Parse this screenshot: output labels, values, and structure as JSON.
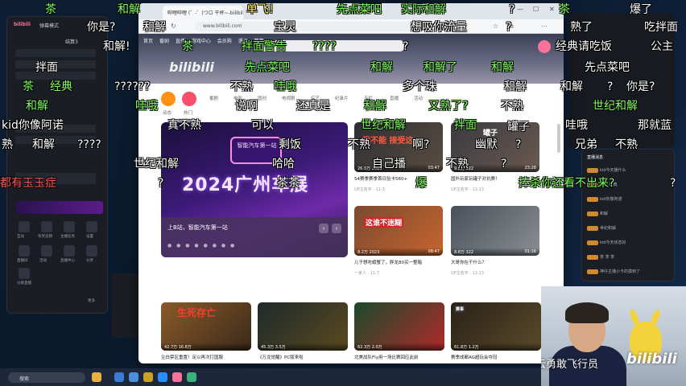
{
  "colors": {
    "accent_pink": "#fb7299",
    "danmaku_green": "#7dff5b",
    "danmaku_white": "#ffffff",
    "danmaku_yellow": "#fff36a",
    "danmaku_red": "#ff5b5b"
  },
  "left_panel": {
    "header_text": "bilibili",
    "header_tab": "弹幕模式",
    "header_right": "结算3",
    "icons": [
      {
        "label": "互动",
        "icon": "interact-icon"
      },
      {
        "label": "有奖竞猜",
        "icon": "gift-icon"
      },
      {
        "label": "主播任务",
        "icon": "task-icon"
      },
      {
        "label": "设置",
        "icon": "gear-icon"
      },
      {
        "label": "直播间",
        "icon": "room-icon"
      },
      {
        "label": "活动",
        "icon": "event-icon"
      },
      {
        "label": "直播中心",
        "icon": "center-icon"
      },
      {
        "label": "分享",
        "icon": "share-icon"
      }
    ],
    "bottom_label": "分屏直播",
    "more_label": "更多"
  },
  "browser": {
    "tab_title": "哔哩哔哩 (゜-゜)つロ 干杯~-bilibili",
    "url": "www.bilibili.com",
    "nav_items": [
      "首页",
      "番剧",
      "直播",
      "游戏中心",
      "会员购",
      "漫画",
      "赛事"
    ],
    "logo": "bilibili",
    "channels": [
      "动态",
      "热门",
      "番剧",
      "电影",
      "国创",
      "电视剧",
      "综艺",
      "纪录片",
      "专栏",
      "直播",
      "活动"
    ],
    "carousel": {
      "big_text": "2024广州车展",
      "sign_text": "智能汽车第一站",
      "caption": "上B站，智能汽车第一站",
      "prev": "‹",
      "next": "›"
    },
    "cards": [
      {
        "thumb_text": "我不能\n接受这",
        "meta": "26.5万  2083",
        "duration": "03:47",
        "title": "S4赛季赛季首日验卡560+",
        "sub": "UP主名字 · 11-3"
      },
      {
        "thumb_text": "罐子",
        "meta": "9.2万  322",
        "duration": "23:28",
        "title": "国外玩家玩罐子对抗赛！",
        "sub": "UP主名字 · 11-13"
      },
      {
        "thumb_text": "这谁不迷糊",
        "meta": "8.2万  2023",
        "duration": "08:47",
        "title": "儿子想吃螃蟹了，胖龙80买一整箱",
        "sub": "一家人 · 11-7"
      },
      {
        "thumb_text": "",
        "meta": "8.8万  322",
        "duration": "01:16",
        "title": "大哥你在干什么？",
        "sub": "UP主名字 · 11-13"
      },
      {
        "thumb_text": "生死存亡",
        "meta": "42.7万  16.8万",
        "duration": "",
        "title": "尘白禁区重置！足以再次打国服",
        "sub": "尘白禁区"
      },
      {
        "thumb_text": "",
        "meta": "45.3万  3.5万",
        "duration": "",
        "title": "《万龙觉醒》PC版来啦",
        "sub": "万龙觉醒"
      },
      {
        "thumb_text": "",
        "meta": "62.3万  2.0万",
        "duration": "",
        "title": "北美战队Fly用一场比赛回应此前",
        "sub": "英雄联盟"
      },
      {
        "thumb_text": "",
        "meta": "61.8万  1.2万",
        "duration": "",
        "title": "赛季成都AG超玩会夺冠",
        "sub": "赛事"
      }
    ],
    "card4_badge": "赛事"
  },
  "right_panel": {
    "header": "直播消息",
    "chat": [
      "kid今天播什么",
      "拌面 经典",
      "kid你像阿诺",
      "和解",
      "世纪和解",
      "kid今天状态好",
      "茶 茶 茶",
      "神仔主播小卡的摸到了"
    ]
  },
  "webcam": {
    "caption": "德云勇敢飞行员",
    "brand": "bilibili"
  },
  "taskbar": {
    "search_label": "搜索"
  },
  "danmaku": [
    {
      "text": "茶",
      "c": "g"
    },
    {
      "text": "和解",
      "c": "g"
    },
    {
      "text": "单飞!",
      "c": "y"
    },
    {
      "text": "先点菜吧",
      "c": "g"
    },
    {
      "text": "实际和解",
      "c": "g"
    },
    {
      "text": "?",
      "c": "w"
    },
    {
      "text": "茶",
      "c": "g"
    },
    {
      "text": "爆了",
      "c": "w"
    },
    {
      "text": "你是?",
      "c": "w"
    },
    {
      "text": "和解",
      "c": "w"
    },
    {
      "text": "宝灵",
      "c": "w"
    },
    {
      "text": "想吸你流量",
      "c": "w"
    },
    {
      "text": "?",
      "c": "w"
    },
    {
      "text": "熟了",
      "c": "w"
    },
    {
      "text": "吃拌面",
      "c": "w"
    },
    {
      "text": "和解!",
      "c": "w"
    },
    {
      "text": "茶",
      "c": "g"
    },
    {
      "text": "拌面警告",
      "c": "g"
    },
    {
      "text": "????",
      "c": "g"
    },
    {
      "text": "?",
      "c": "w"
    },
    {
      "text": "经典请吃饭",
      "c": "w"
    },
    {
      "text": "公主",
      "c": "w"
    },
    {
      "text": "拌面",
      "c": "w"
    },
    {
      "text": "先点菜吧",
      "c": "g"
    },
    {
      "text": "和解",
      "c": "g"
    },
    {
      "text": "和解了",
      "c": "g"
    },
    {
      "text": "和解",
      "c": "g"
    },
    {
      "text": "先点菜吧",
      "c": "w"
    },
    {
      "text": "茶",
      "c": "g"
    },
    {
      "text": "经典",
      "c": "g"
    },
    {
      "text": "??????",
      "c": "w"
    },
    {
      "text": "不熟",
      "c": "w"
    },
    {
      "text": "哇哦",
      "c": "g"
    },
    {
      "text": "多个珠",
      "c": "w"
    },
    {
      "text": "和解",
      "c": "w"
    },
    {
      "text": "和解",
      "c": "w"
    },
    {
      "text": "?",
      "c": "w"
    },
    {
      "text": "你是?",
      "c": "w"
    },
    {
      "text": "和解",
      "c": "g"
    },
    {
      "text": "哇哦",
      "c": "g"
    },
    {
      "text": "说啊",
      "c": "w"
    },
    {
      "text": "还真是",
      "c": "w"
    },
    {
      "text": "和解",
      "c": "g"
    },
    {
      "text": "又熟了?",
      "c": "g"
    },
    {
      "text": "不熟",
      "c": "w"
    },
    {
      "text": "世纪和解",
      "c": "g"
    },
    {
      "text": "kid你像阿诺",
      "c": "w"
    },
    {
      "text": "真不熟",
      "c": "w"
    },
    {
      "text": "可以",
      "c": "w"
    },
    {
      "text": "世纪和解",
      "c": "g"
    },
    {
      "text": "拌面",
      "c": "g"
    },
    {
      "text": "哇哦",
      "c": "w"
    },
    {
      "text": "那就蓝",
      "c": "w"
    },
    {
      "text": "熟",
      "c": "w"
    },
    {
      "text": "和解",
      "c": "w"
    },
    {
      "text": "????",
      "c": "w"
    },
    {
      "text": "剩饭",
      "c": "w"
    },
    {
      "text": "不熟",
      "c": "w"
    },
    {
      "text": "啊?",
      "c": "w"
    },
    {
      "text": "幽默",
      "c": "w"
    },
    {
      "text": "?",
      "c": "w"
    },
    {
      "text": "兄弟",
      "c": "w"
    },
    {
      "text": "不熟",
      "c": "w"
    },
    {
      "text": "世纪和解",
      "c": "w"
    },
    {
      "text": "哈哈",
      "c": "w"
    },
    {
      "text": "自己播",
      "c": "w"
    },
    {
      "text": "不熟",
      "c": "w"
    },
    {
      "text": "?",
      "c": "w"
    },
    {
      "text": "罐子",
      "c": "w"
    },
    {
      "text": "都有玉玉症",
      "c": "r"
    },
    {
      "text": "茶茶",
      "c": "w"
    },
    {
      "text": "爆",
      "c": "g"
    },
    {
      "text": "捧杀你还看不出来?",
      "c": "g"
    },
    {
      "text": "?",
      "c": "w"
    },
    {
      "text": "?",
      "c": "w"
    }
  ]
}
